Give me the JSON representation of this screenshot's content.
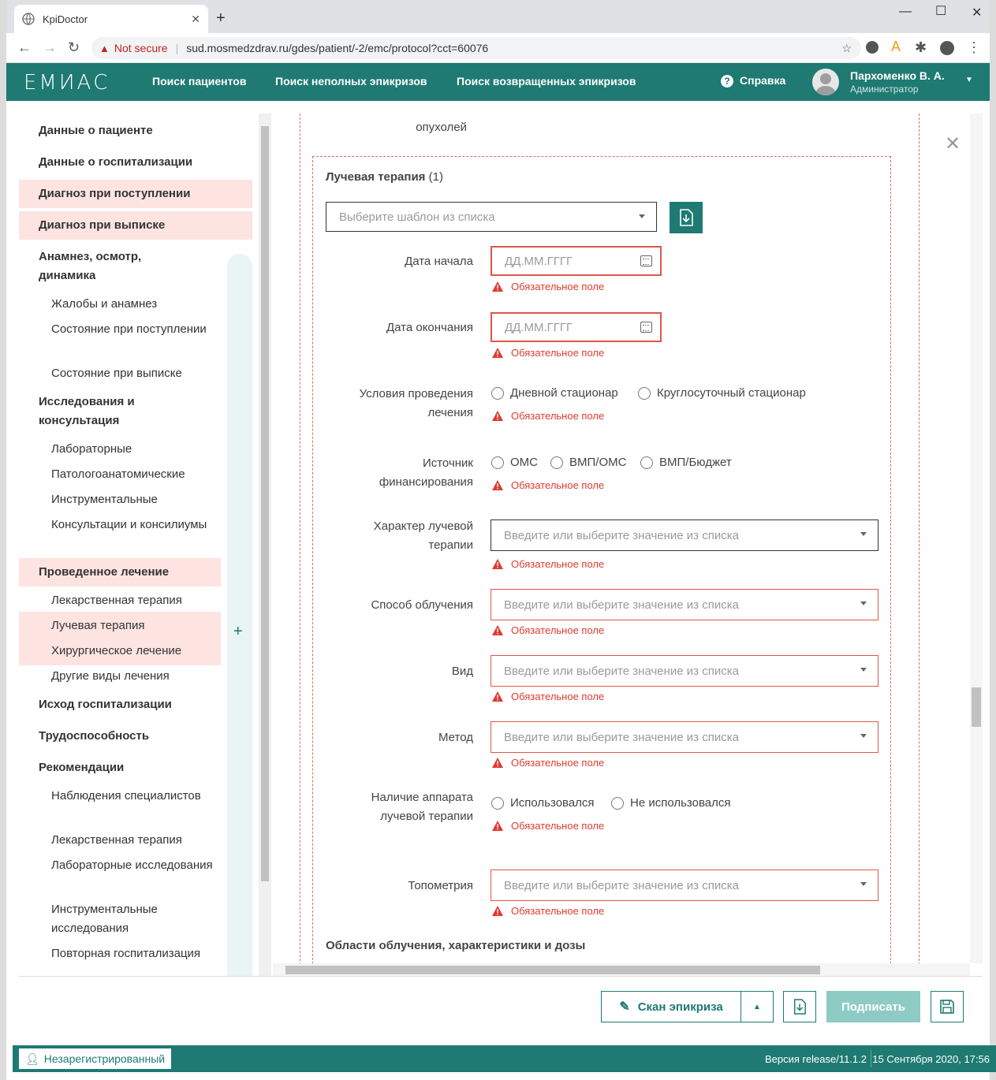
{
  "browser": {
    "tab_title": "KpiDoctor",
    "not_secure": "Not secure",
    "url": "sud.mosmedzdrav.ru/gdes/patient/-2/emc/protocol?cct=60076"
  },
  "header": {
    "logo": "ЕМИАС",
    "nav": [
      "Поиск пациентов",
      "Поиск неполных эпикризов",
      "Поиск возвращенных эпикризов"
    ],
    "help": "Справка",
    "user_name": "Пархоменко В. А.",
    "user_role": "Администратор"
  },
  "sidebar": {
    "items": [
      {
        "label": "Данные о пациенте",
        "type": "h"
      },
      {
        "label": "Данные о госпитализации",
        "type": "h"
      },
      {
        "label": "Диагноз при поступлении",
        "type": "h",
        "err": true
      },
      {
        "label": "Диагноз при выписке",
        "type": "h",
        "err": true
      },
      {
        "label": "Анамнез, осмотр, динамика",
        "type": "h"
      },
      {
        "label": "Жалобы и анамнез",
        "type": "sub"
      },
      {
        "label": "Состояние при поступлении",
        "type": "sub"
      },
      {
        "label": "Состояние при выписке",
        "type": "sub"
      },
      {
        "label": "Исследования и консультация",
        "type": "h"
      },
      {
        "label": "Лабораторные",
        "type": "sub"
      },
      {
        "label": "Патологоанатомические",
        "type": "sub"
      },
      {
        "label": "Инструментальные",
        "type": "sub"
      },
      {
        "label": "Консультации и консилиумы",
        "type": "sub"
      },
      {
        "label": "Проведенное лечение",
        "type": "h",
        "err": true
      },
      {
        "label": "Лекарственная терапия",
        "type": "sub"
      },
      {
        "label": "Лучевая терапия",
        "type": "sub",
        "err": true
      },
      {
        "label": "Хирургическое лечение",
        "type": "sub",
        "err": true
      },
      {
        "label": "Другие виды лечения",
        "type": "sub"
      },
      {
        "label": "Исход госпитализации",
        "type": "h"
      },
      {
        "label": "Трудоспособность",
        "type": "h"
      },
      {
        "label": "Рекомендации",
        "type": "h"
      },
      {
        "label": "Наблюдения специалистов",
        "type": "sub"
      },
      {
        "label": "Лекарственная терапия",
        "type": "sub"
      },
      {
        "label": "Лабораторные исследования",
        "type": "sub"
      },
      {
        "label": "Инструментальные исследования",
        "type": "sub"
      },
      {
        "label": "Повторная госпитализация",
        "type": "sub"
      }
    ],
    "plus": "+"
  },
  "form": {
    "top_label": "опухолей",
    "section_title": "Лучевая терапия",
    "section_count": "(1)",
    "template_placeholder": "Выберите шаблон из списка",
    "required": "Обязательное поле",
    "date_placeholder": "ДД.ММ.ГГГГ",
    "select_placeholder": "Введите или выберите значение из списка",
    "start_date": "Дата начала",
    "end_date": "Дата окончания",
    "conditions": "Условия проведения лечения",
    "conditions_opts": [
      "Дневной стационар",
      "Круглосуточный стационар"
    ],
    "finance": "Источник финансирования",
    "finance_opts": [
      "ОМС",
      "ВМП/ОМС",
      "ВМП/Бюджет"
    ],
    "character": "Характер лучевой терапии",
    "method_irr": "Способ облучения",
    "kind": "Вид",
    "method": "Метод",
    "apparatus": "Наличие аппарата лучевой терапии",
    "apparatus_opts": [
      "Использовался",
      "Не использовался"
    ],
    "topometry": "Топометрия",
    "areas_title": "Области облучения, характеристики и дозы"
  },
  "bottom": {
    "scan": "Скан эпикриза",
    "sign": "Подписать"
  },
  "status": {
    "guest": "Незарегистрированный",
    "version": "Версия release/11.1.2",
    "datetime": "15 Сентября 2020, 17:56"
  },
  "colors": {
    "primary": "#1e7a72",
    "error": "#e03a2f",
    "error_bg": "#fde4e1"
  }
}
